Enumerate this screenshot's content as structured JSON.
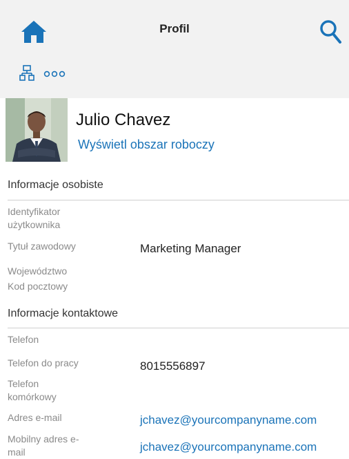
{
  "header": {
    "title": "Profil",
    "background": "#f2f2f2",
    "accent": "#1a73b8",
    "icons": [
      "home-icon",
      "search-icon",
      "org-chart-icon",
      "more-icon"
    ]
  },
  "profile": {
    "name": "Julio Chavez",
    "workspace_link": "Wyświetl obszar roboczy"
  },
  "personal": {
    "title": "Informacje osobiste",
    "user_id_label_1": "Identyfikator",
    "user_id_label_2": "użytkownika",
    "job_title_label": "Tytuł zawodowy",
    "job_title_value": "Marketing Manager",
    "province_label": "Województwo",
    "postal_label": "Kod pocztowy"
  },
  "contact": {
    "title": "Informacje kontaktowe",
    "phone_label": "Telefon",
    "work_phone_label": "Telefon do pracy",
    "work_phone_value": "8015556897",
    "mobile_label_1": "Telefon",
    "mobile_label_2": "komórkowy",
    "email_label": "Adres e-mail",
    "email_value": "jchavez@yourcompanyname.com",
    "mobile_email_label_1": "Mobilny adres e-",
    "mobile_email_label_2": "mail",
    "mobile_email_value": "jchavez@yourcompanyname.com"
  }
}
